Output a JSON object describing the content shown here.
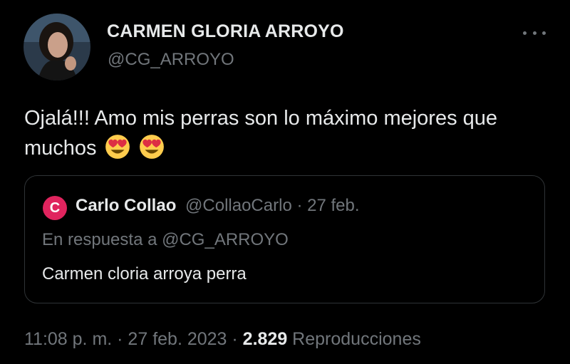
{
  "author": {
    "display_name": "CARMEN GLORIA ARROYO",
    "handle": "@CG_ARROYO",
    "avatar": "profile-photo"
  },
  "tweet": {
    "text": "Ojalá!!! Amo mis perras son lo máximo mejores que muchos",
    "emojis": [
      "heart-eyes-emoji",
      "heart-eyes-emoji"
    ]
  },
  "quoted": {
    "avatar_letter": "C",
    "avatar_color": "#e0245e",
    "name": "Carlo Collao",
    "meta": "@CollaoCarlo · 27 feb.",
    "reply_to": "En respuesta a @CG_ARROYO",
    "text": "Carmen cloria arroya perra"
  },
  "footer": {
    "time_date": "11:08 p. m. · 27 feb. 2023 · ",
    "views_count": "2.829",
    "views_label": " Reproducciones"
  },
  "colors": {
    "background": "#000000",
    "primary_text": "#e7e9ea",
    "secondary_text": "#71767b",
    "border": "#2f3336"
  }
}
